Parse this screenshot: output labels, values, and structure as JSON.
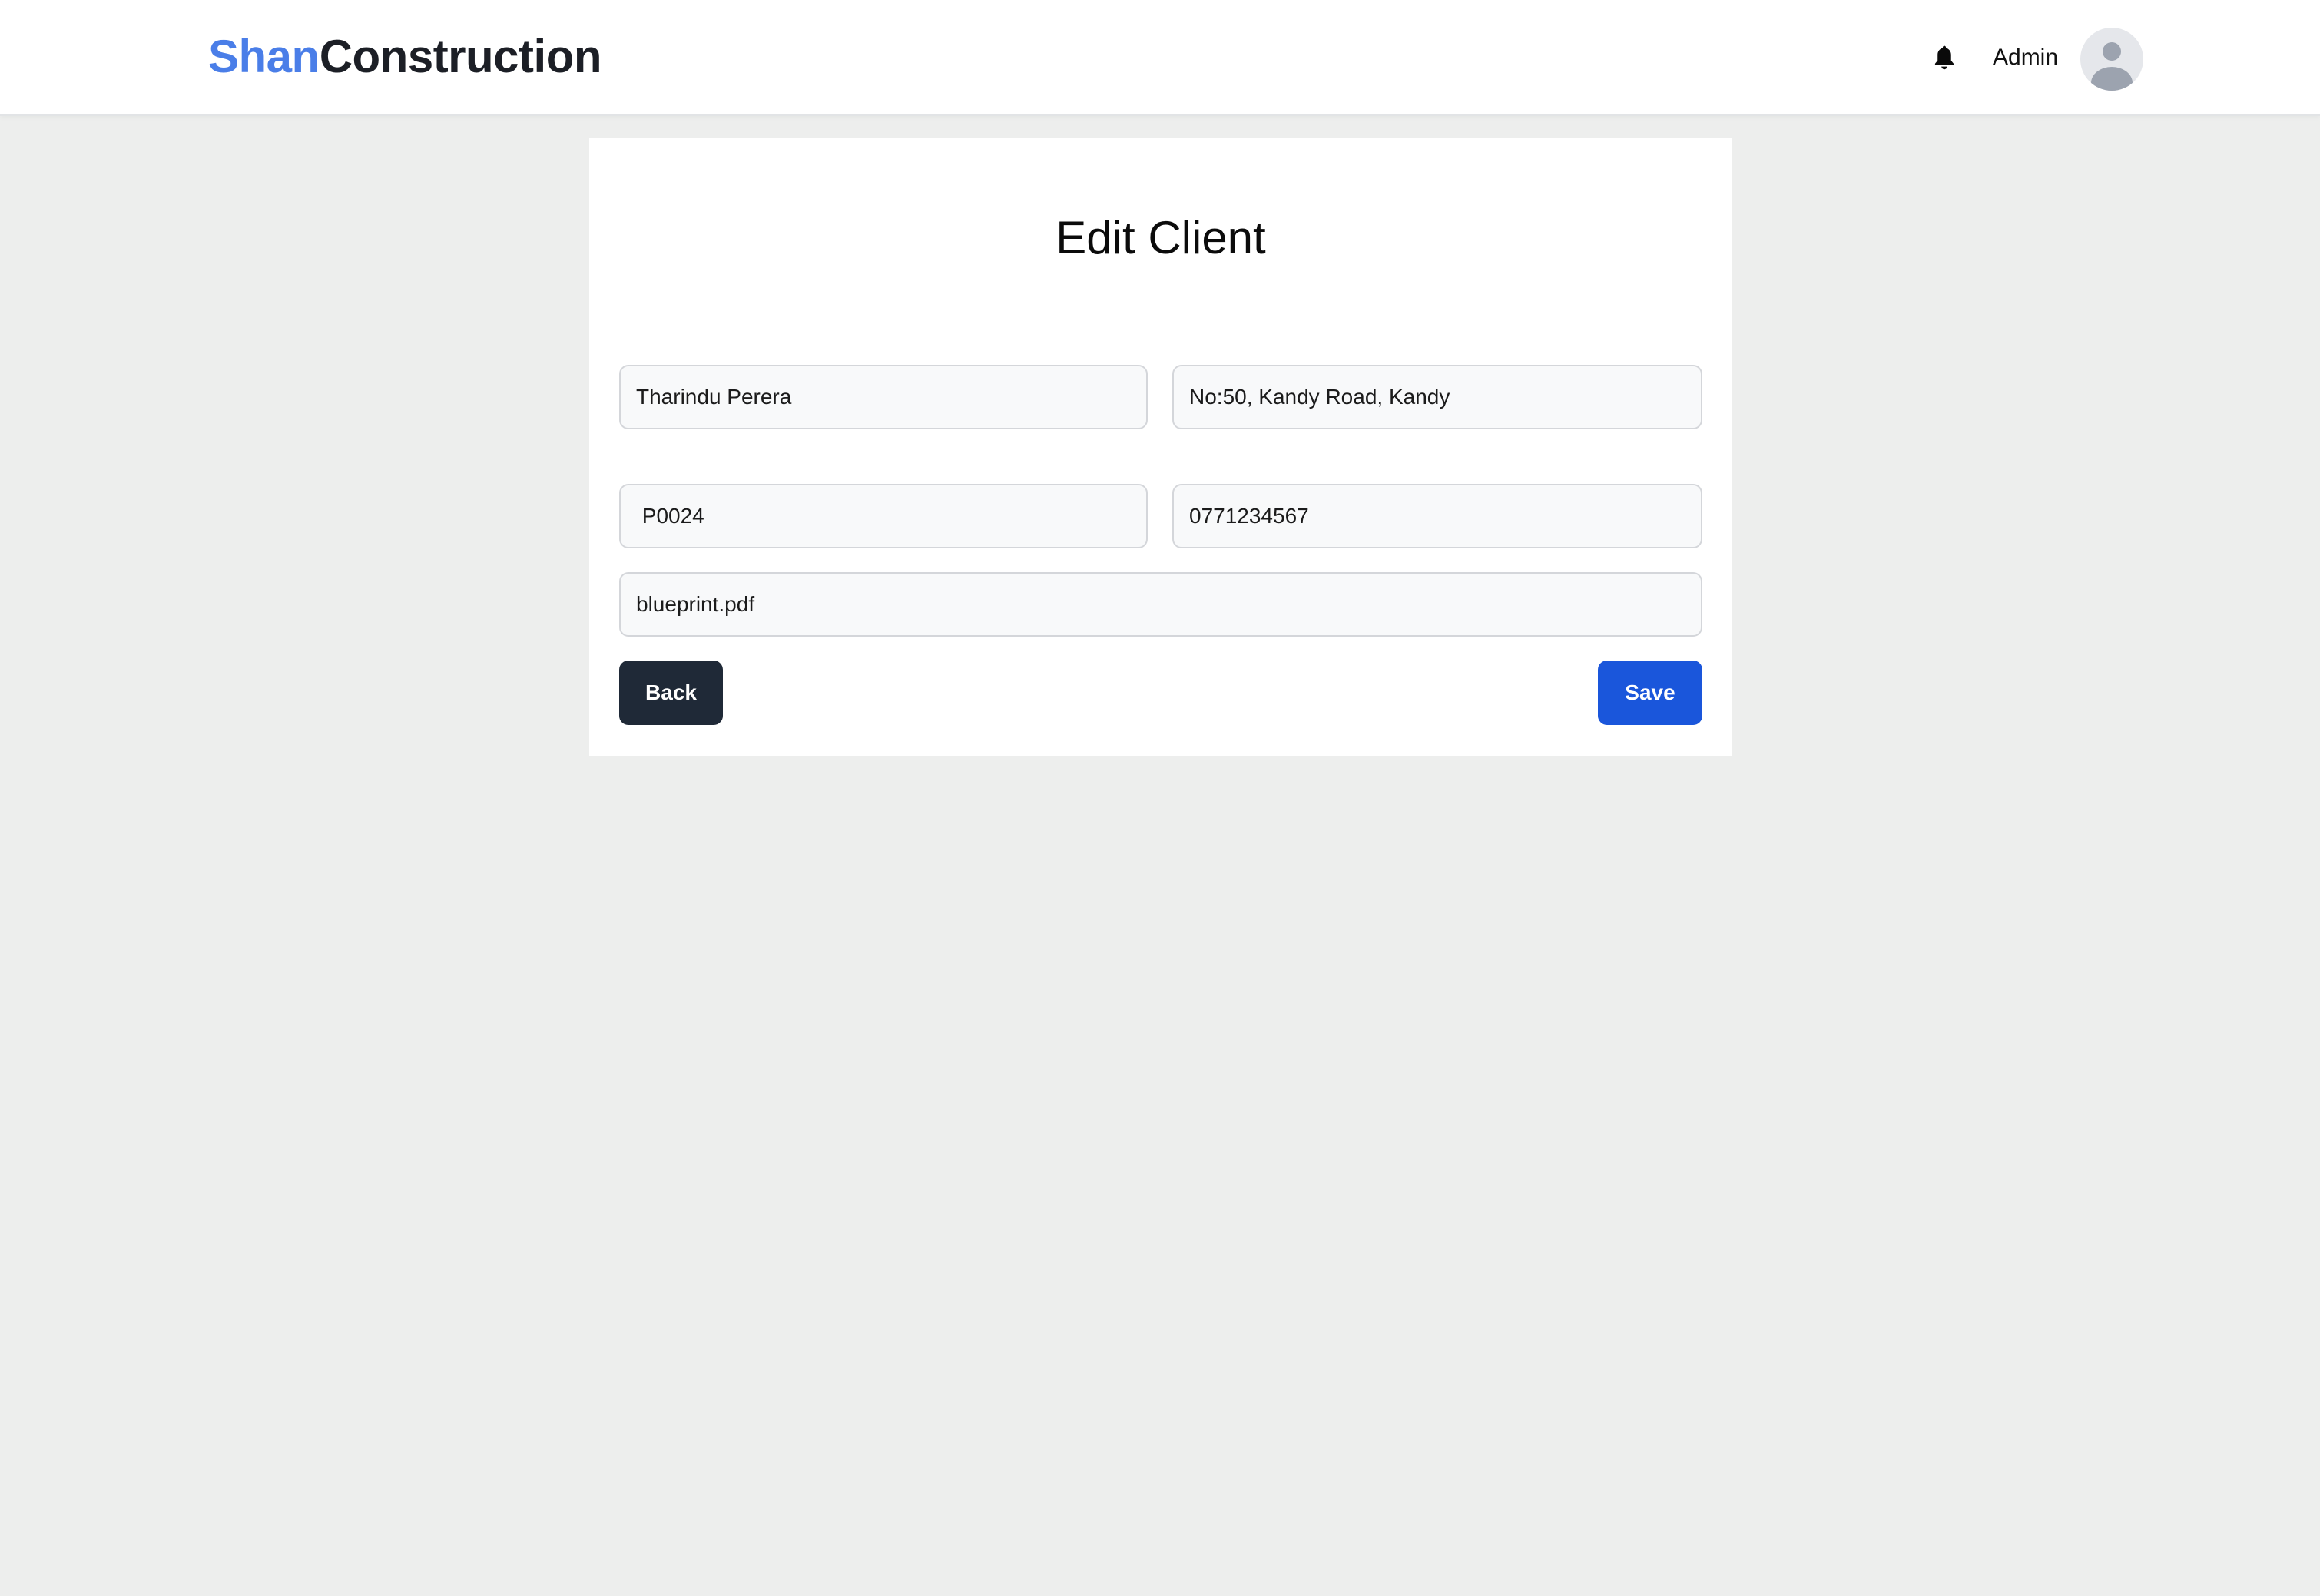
{
  "header": {
    "brand_primary": "Shan",
    "brand_secondary": "Construction",
    "user_name": "Admin",
    "notification_icon": "bell-icon",
    "avatar_icon": "user-avatar-icon"
  },
  "form": {
    "title": "Edit Client",
    "client_name": "Tharindu Perera",
    "address": "No:50, Kandy Road, Kandy",
    "project_id": " P0024",
    "phone": "0771234567",
    "document": "blueprint.pdf",
    "back_label": "Back",
    "save_label": "Save"
  },
  "colors": {
    "brand_accent": "#4a7ee8",
    "primary_button": "#1a56db",
    "secondary_button": "#1f2937",
    "page_background": "#edeeed"
  }
}
